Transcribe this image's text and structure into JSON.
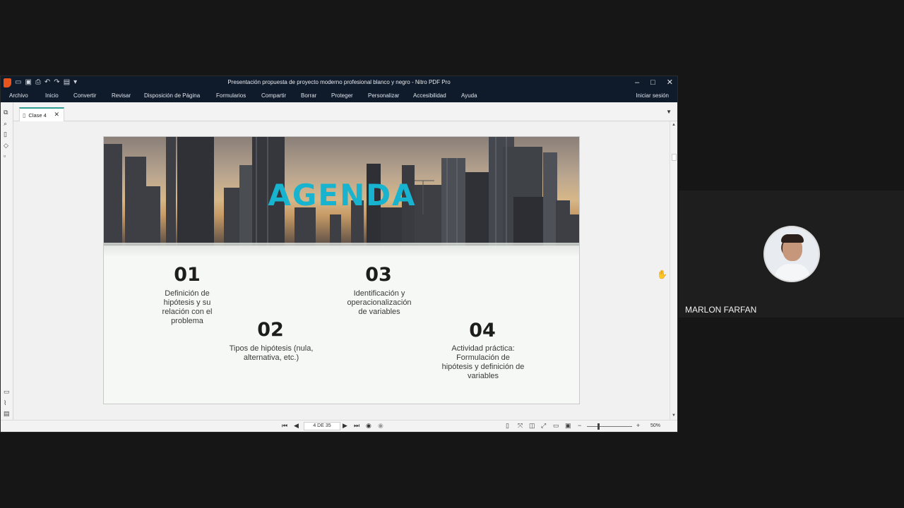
{
  "window": {
    "title": "Presentación propuesta de proyecto moderno profesional blanco y negro - Nitro PDF Pro"
  },
  "menu": {
    "items": [
      "Archivo",
      "Inicio",
      "Convertir",
      "Revisar",
      "Disposición de Página",
      "Formularios",
      "Compartir",
      "Borrar",
      "Proteger",
      "Personalizar",
      "Accesibilidad",
      "Ayuda"
    ],
    "signin": "Iniciar sesión"
  },
  "tab": {
    "label": "Clase 4"
  },
  "slide": {
    "title": "AGENDA",
    "items": [
      {
        "num": "01",
        "text": "Definición de hipótesis y su relación con el problema"
      },
      {
        "num": "02",
        "text": "Tipos de hipótesis (nula, alternativa, etc.)"
      },
      {
        "num": "03",
        "text": "Identificación y operacionalización de variables"
      },
      {
        "num": "04",
        "text": "Actividad práctica: Formulación de hipótesis y definición de variables"
      }
    ]
  },
  "status": {
    "page": "4 DE 35",
    "zoom": "50%"
  },
  "participant": {
    "name": "MARLON FARFAN"
  },
  "colors": {
    "accent": "#17b3cf",
    "titlebar": "#0f1a2b",
    "tab_accent": "#2f9d8f"
  }
}
